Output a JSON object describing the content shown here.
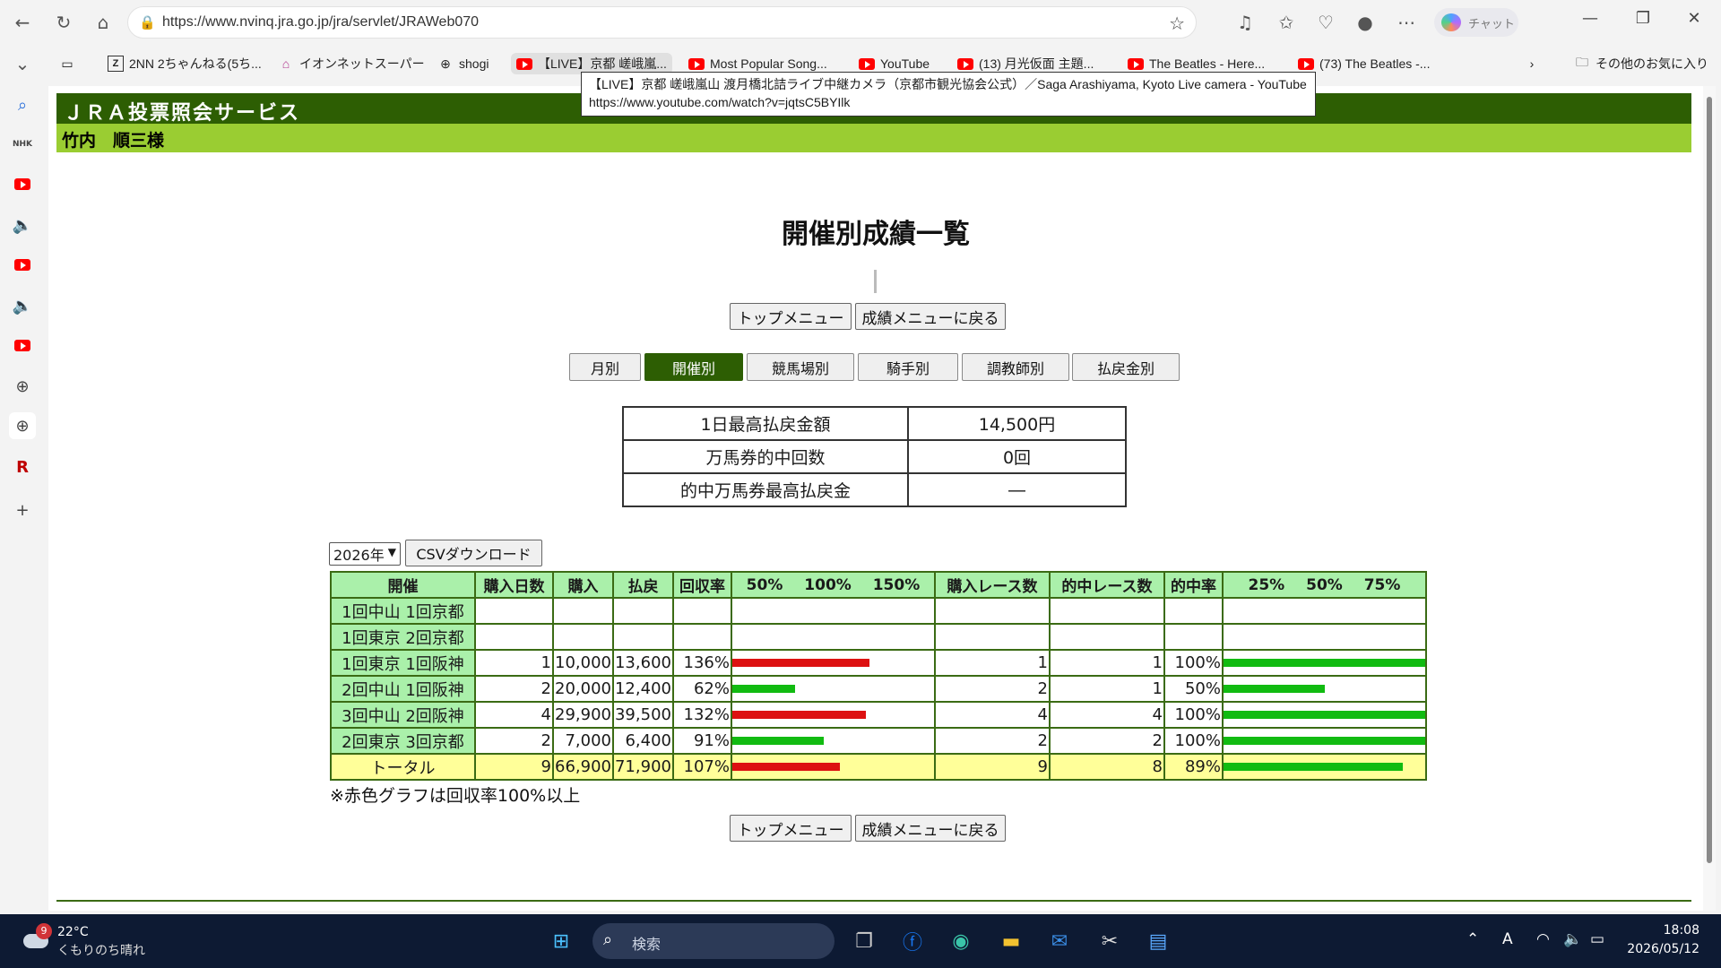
{
  "browser": {
    "url": "https://www.nvinq.jra.go.jp/jra/servlet/JRAWeb070",
    "copilot_label": "チャット",
    "bookmarks": [
      {
        "label": "2NN 2ちゃんねる(5ち...",
        "icon": "2nn-icon"
      },
      {
        "label": "イオンネットスーパー",
        "icon": "home-icon"
      },
      {
        "label": "shogi",
        "icon": "globe-icon"
      },
      {
        "label": "【LIVE】京都 嵯峨嵐...",
        "icon": "youtube-icon"
      },
      {
        "label": "Most Popular Song...",
        "icon": "youtube-icon"
      },
      {
        "label": "YouTube",
        "icon": "youtube-icon"
      },
      {
        "label": "(13) 月光仮面 主題...",
        "icon": "youtube-icon"
      },
      {
        "label": "The Beatles - Here...",
        "icon": "youtube-icon"
      },
      {
        "label": "(73) The Beatles -...",
        "icon": "youtube-icon"
      }
    ],
    "other_favorites": "その他のお気に入り",
    "tooltip": {
      "line1": "【LIVE】京都 嵯峨嵐山 渡月橋北詰ライブ中継カメラ（京都市観光協会公式）／Saga Arashiyama, Kyoto Live camera - YouTube",
      "line2": "https://www.youtube.com/watch?v=jqtsC5BYIlk"
    }
  },
  "page": {
    "service_title": "ＪＲＡ投票照会サービス",
    "user_name": "竹内　順三様",
    "title": "開催別成績一覧",
    "top_menu": "トップメニュー",
    "back_menu": "成績メニューに戻る",
    "tabs": [
      "月別",
      "開催別",
      "競馬場別",
      "騎手別",
      "調教師別",
      "払戻金別"
    ],
    "selected_tab": "開催別",
    "summary": [
      {
        "label": "1日最高払戻金額",
        "value": "14,500円"
      },
      {
        "label": "万馬券的中回数",
        "value": "0回"
      },
      {
        "label": "的中万馬券最高払戻金",
        "value": "―"
      }
    ],
    "year_select": "2026年",
    "csv_button": "CSVダウンロード",
    "note": "※赤色グラフは回収率100%以上"
  },
  "colors": {
    "header_green": "#2d5e03",
    "user_green": "#9acd32",
    "cell_green": "#aaf0aa",
    "total_yellow": "#ffff99",
    "bar_red": "#dd1111",
    "bar_green": "#11bb11"
  },
  "table": {
    "headers": {
      "kaisai": "開催",
      "days": "購入日数",
      "buy": "購入",
      "payout": "払戻",
      "return_rate": "回収率",
      "return_scale": "50% 100% 150%",
      "races": "購入レース数",
      "hit_races": "的中レース数",
      "hit_rate": "的中率",
      "hit_scale": "25% 50% 75%"
    },
    "rows": [
      {
        "kaisai": "1回中山 1回京都",
        "days": "",
        "buy": "",
        "payout": "",
        "return_rate": "",
        "return_value": null,
        "races": "",
        "hit_races": "",
        "hit_rate": "",
        "hit_value": null
      },
      {
        "kaisai": "1回東京 2回京都",
        "days": "",
        "buy": "",
        "payout": "",
        "return_rate": "",
        "return_value": null,
        "races": "",
        "hit_races": "",
        "hit_rate": "",
        "hit_value": null
      },
      {
        "kaisai": "1回東京 1回阪神",
        "days": "1",
        "buy": "10,000",
        "payout": "13,600",
        "return_rate": "136%",
        "return_value": 136,
        "races": "1",
        "hit_races": "1",
        "hit_rate": "100%",
        "hit_value": 100
      },
      {
        "kaisai": "2回中山 1回阪神",
        "days": "2",
        "buy": "20,000",
        "payout": "12,400",
        "return_rate": "62%",
        "return_value": 62,
        "races": "2",
        "hit_races": "1",
        "hit_rate": "50%",
        "hit_value": 50
      },
      {
        "kaisai": "3回中山 2回阪神",
        "days": "4",
        "buy": "29,900",
        "payout": "39,500",
        "return_rate": "132%",
        "return_value": 132,
        "races": "4",
        "hit_races": "4",
        "hit_rate": "100%",
        "hit_value": 100
      },
      {
        "kaisai": "2回東京 3回京都",
        "days": "2",
        "buy": "7,000",
        "payout": "6,400",
        "return_rate": "91%",
        "return_value": 91,
        "races": "2",
        "hit_races": "2",
        "hit_rate": "100%",
        "hit_value": 100
      }
    ],
    "total": {
      "kaisai": "トータル",
      "days": "9",
      "buy": "66,900",
      "payout": "71,900",
      "return_rate": "107%",
      "return_value": 107,
      "races": "9",
      "hit_races": "8",
      "hit_rate": "89%",
      "hit_value": 89
    }
  },
  "taskbar": {
    "temperature": "22°C",
    "weather": "くもりのち晴れ",
    "weather_badge": "9",
    "search_placeholder": "検索",
    "time": "18:08",
    "date": "2026/05/12",
    "ime": "A"
  }
}
